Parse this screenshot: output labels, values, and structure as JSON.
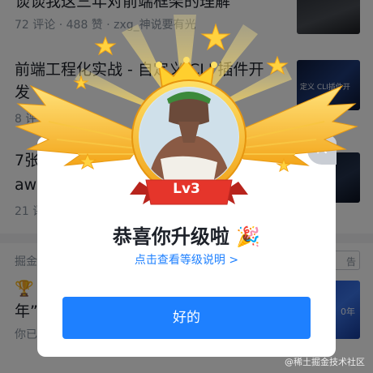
{
  "feed": {
    "articles": [
      {
        "title": "谈谈我这三年对前端框架的理解",
        "comments": "72 评论",
        "views": "488 赞",
        "author": "zxg_神说要有光"
      },
      {
        "title": "前端工程化实战 - 自定义 CLI 插件开",
        "title_line2": "发",
        "comments": "8 评论",
        "thumb_text": "定义 CLI插件开"
      },
      {
        "title": "7张",
        "title_line2": "awa",
        "comments": "21 评"
      },
      {
        "title": "年”",
        "comments": "你已"
      }
    ],
    "ad_label": "掘金",
    "report_label": "告",
    "ad_thumb_text": "0年"
  },
  "dialog": {
    "level_badge": "Lv3",
    "title": "恭喜你升级啦 🎉",
    "level_link": "点击查看等级说明 >",
    "ok_label": "好的",
    "close_glyph": "×"
  },
  "watermark": "@稀土掘金技术社区",
  "colors": {
    "accent_blue": "#1e80ff",
    "gold": "#f5b21b",
    "ribbon_red": "#e5352b",
    "mask": "rgba(0,0,0,0.5)"
  }
}
